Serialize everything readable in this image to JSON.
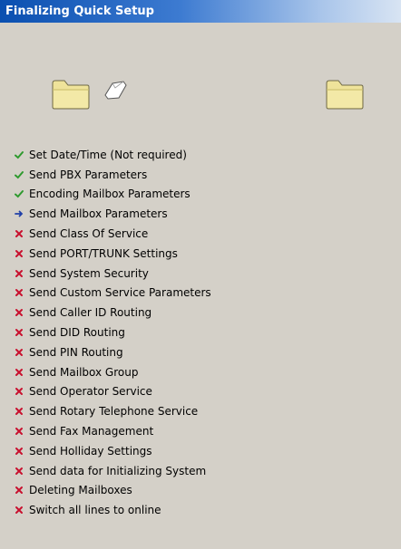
{
  "window": {
    "title": "Finalizing Quick Setup"
  },
  "icons": {
    "source": "folder-icon",
    "transfer": "document-icon",
    "destination": "folder-icon"
  },
  "colors": {
    "title_bar": "#0a4fb0",
    "background": "#d4d0c8",
    "done": "#2e9a2e",
    "current": "#1f3fa8",
    "pending": "#c8102e"
  },
  "steps": [
    {
      "label": "Set Date/Time (Not required)",
      "status": "done"
    },
    {
      "label": "Send PBX Parameters",
      "status": "done"
    },
    {
      "label": "Encoding Mailbox Parameters",
      "status": "done"
    },
    {
      "label": "Send Mailbox Parameters",
      "status": "current"
    },
    {
      "label": "Send Class Of Service",
      "status": "pending"
    },
    {
      "label": "Send PORT/TRUNK Settings",
      "status": "pending"
    },
    {
      "label": "Send System Security",
      "status": "pending"
    },
    {
      "label": "Send Custom Service Parameters",
      "status": "pending"
    },
    {
      "label": "Send Caller ID Routing",
      "status": "pending"
    },
    {
      "label": "Send DID Routing",
      "status": "pending"
    },
    {
      "label": "Send PIN Routing",
      "status": "pending"
    },
    {
      "label": "Send Mailbox Group",
      "status": "pending"
    },
    {
      "label": "Send Operator Service",
      "status": "pending"
    },
    {
      "label": "Send Rotary Telephone Service",
      "status": "pending"
    },
    {
      "label": "Send Fax Management",
      "status": "pending"
    },
    {
      "label": "Send Holliday Settings",
      "status": "pending"
    },
    {
      "label": "Send data for Initializing System",
      "status": "pending"
    },
    {
      "label": "Deleting Mailboxes",
      "status": "pending"
    },
    {
      "label": "Switch all lines to online",
      "status": "pending"
    }
  ]
}
